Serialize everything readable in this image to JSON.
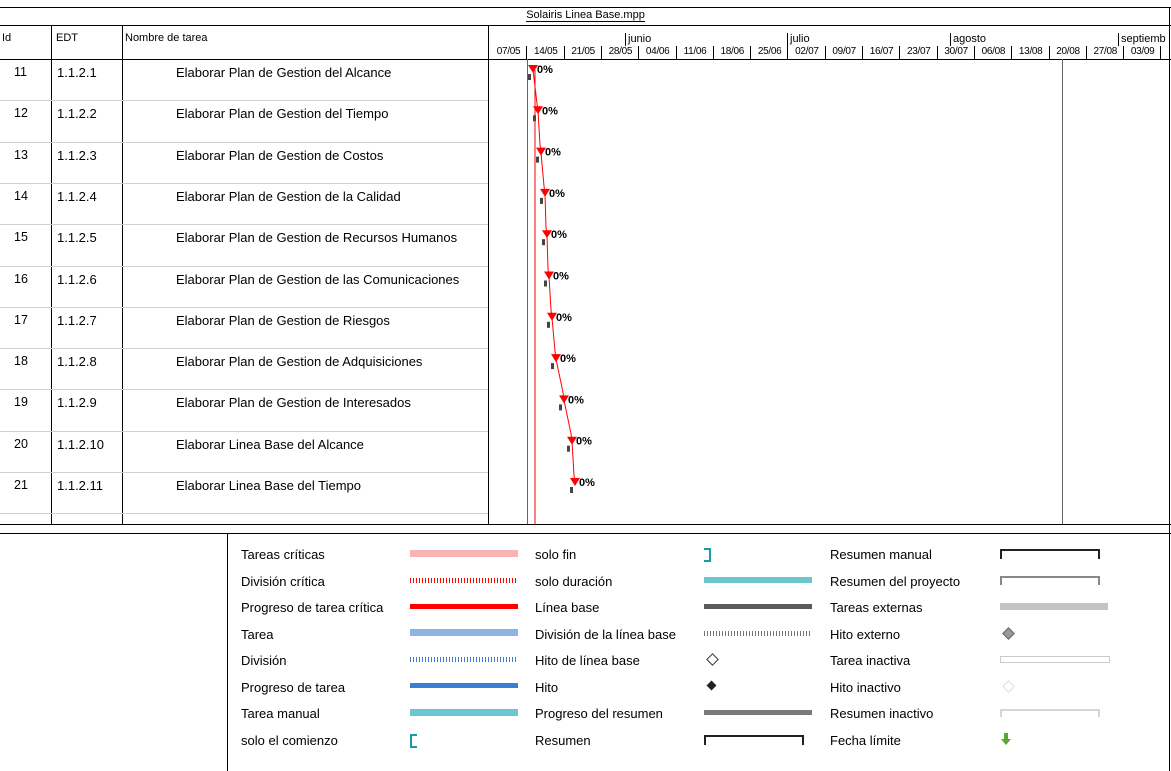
{
  "project_title": "Solairis Linea Base.mpp",
  "columns": {
    "id": "Id",
    "edt": "EDT",
    "name": "Nombre de tarea"
  },
  "timeline": {
    "months": [
      "junio",
      "julio",
      "agosto",
      "septiemb"
    ],
    "weeks": [
      "07/05",
      "14/05",
      "21/05",
      "28/05",
      "04/06",
      "11/06",
      "18/06",
      "25/06",
      "02/07",
      "09/07",
      "16/07",
      "23/07",
      "30/07",
      "06/08",
      "13/08",
      "20/08",
      "27/08",
      "03/09"
    ]
  },
  "tasks": [
    {
      "id": "11",
      "edt": "1.1.2.1",
      "name": "Elaborar Plan de Gestion del Alcance",
      "progress": "0%"
    },
    {
      "id": "12",
      "edt": "1.1.2.2",
      "name": "Elaborar Plan de Gestion del Tiempo",
      "progress": "0%"
    },
    {
      "id": "13",
      "edt": "1.1.2.3",
      "name": "Elaborar Plan de Gestion de Costos",
      "progress": "0%"
    },
    {
      "id": "14",
      "edt": "1.1.2.4",
      "name": "Elaborar Plan de Gestion de la Calidad",
      "progress": "0%"
    },
    {
      "id": "15",
      "edt": "1.1.2.5",
      "name": "Elaborar Plan de Gestion de Recursos Humanos",
      "progress": "0%"
    },
    {
      "id": "16",
      "edt": "1.1.2.6",
      "name": "Elaborar Plan de Gestion de las Comunicaciones",
      "progress": "0%"
    },
    {
      "id": "17",
      "edt": "1.1.2.7",
      "name": "Elaborar Plan de Gestion de Riesgos",
      "progress": "0%"
    },
    {
      "id": "18",
      "edt": "1.1.2.8",
      "name": "Elaborar Plan de Gestion de Adquisiciones",
      "progress": "0%"
    },
    {
      "id": "19",
      "edt": "1.1.2.9",
      "name": "Elaborar Plan de Gestion de Interesados",
      "progress": "0%"
    },
    {
      "id": "20",
      "edt": "1.1.2.10",
      "name": "Elaborar Linea Base del Alcance",
      "progress": "0%"
    },
    {
      "id": "21",
      "edt": "1.1.2.11",
      "name": "Elaborar Linea Base del Tiempo",
      "progress": "0%"
    }
  ],
  "legend": [
    {
      "label": "Tareas críticas",
      "symbol": "critical-task"
    },
    {
      "label": "División crítica",
      "symbol": "critical-split"
    },
    {
      "label": "Progreso de tarea crítica",
      "symbol": "critical-progress"
    },
    {
      "label": "Tarea",
      "symbol": "task"
    },
    {
      "label": "División",
      "symbol": "split"
    },
    {
      "label": "Progreso de tarea",
      "symbol": "task-progress"
    },
    {
      "label": "Tarea manual",
      "symbol": "manual-task"
    },
    {
      "label": "solo el comienzo",
      "symbol": "start-only"
    },
    {
      "label": "solo fin",
      "symbol": "finish-only"
    },
    {
      "label": "solo duración",
      "symbol": "duration-only"
    },
    {
      "label": "Línea base",
      "symbol": "baseline"
    },
    {
      "label": "División de la línea base",
      "symbol": "baseline-split"
    },
    {
      "label": "Hito de línea base",
      "symbol": "baseline-milestone"
    },
    {
      "label": "Hito",
      "symbol": "milestone"
    },
    {
      "label": "Progreso del resumen",
      "symbol": "summary-progress"
    },
    {
      "label": "Resumen",
      "symbol": "summary"
    },
    {
      "label": "Resumen manual",
      "symbol": "manual-summary"
    },
    {
      "label": "Resumen del proyecto",
      "symbol": "project-summary"
    },
    {
      "label": "Tareas externas",
      "symbol": "external-tasks"
    },
    {
      "label": "Hito externo",
      "symbol": "external-milestone"
    },
    {
      "label": "Tarea inactiva",
      "symbol": "inactive-task"
    },
    {
      "label": "Hito inactivo",
      "symbol": "inactive-milestone"
    },
    {
      "label": "Resumen inactivo",
      "symbol": "inactive-summary"
    },
    {
      "label": "Fecha límite",
      "symbol": "deadline-arrow-icon"
    }
  ],
  "colors": {
    "critical": "#ff0000",
    "critical_task": "#f8b4b4",
    "task": "#8db4e2",
    "task_progress": "#3a7fd5",
    "manual_teal": "#6cc6d0",
    "baseline": "#5a5a5a",
    "deadline": "#5aa832"
  }
}
